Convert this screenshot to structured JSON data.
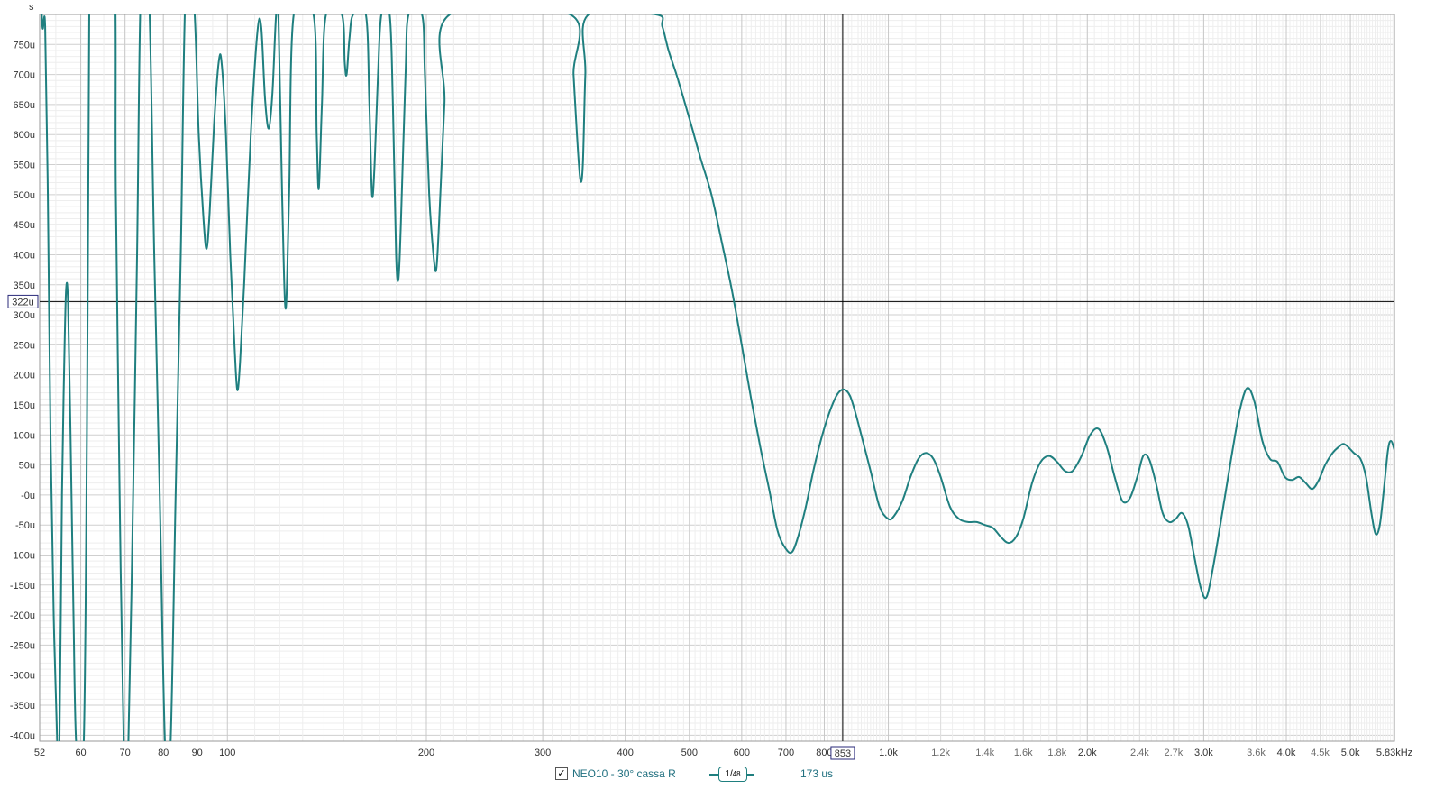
{
  "chart_data": {
    "type": "line",
    "y_unit_label": "s",
    "x_scale": "log",
    "x_range_hz": [
      52,
      5830
    ],
    "y_range_us": [
      -410,
      800
    ],
    "yticks": [
      750,
      700,
      650,
      600,
      550,
      500,
      450,
      400,
      350,
      300,
      250,
      200,
      150,
      100,
      50,
      0,
      -50,
      -100,
      -150,
      -200,
      -250,
      -300,
      -350,
      -400
    ],
    "ytick_labels": [
      "750u",
      "700u",
      "650u",
      "600u",
      "550u",
      "500u",
      "450u",
      "400u",
      "350u",
      "300u",
      "250u",
      "200u",
      "150u",
      "100u",
      "50u",
      "-0u",
      "-50u",
      "-100u",
      "-150u",
      "-200u",
      "-250u",
      "-300u",
      "-350u",
      "-400u"
    ],
    "xticks": [
      {
        "v": 52,
        "label": "52",
        "major": true
      },
      {
        "v": 60,
        "label": "60",
        "major": true
      },
      {
        "v": 70,
        "label": "70",
        "major": true
      },
      {
        "v": 80,
        "label": "80",
        "major": true
      },
      {
        "v": 90,
        "label": "90",
        "major": true
      },
      {
        "v": 100,
        "label": "100",
        "major": true
      },
      {
        "v": 200,
        "label": "200",
        "major": true
      },
      {
        "v": 300,
        "label": "300",
        "major": true
      },
      {
        "v": 400,
        "label": "400",
        "major": true
      },
      {
        "v": 500,
        "label": "500",
        "major": true
      },
      {
        "v": 600,
        "label": "600",
        "major": true
      },
      {
        "v": 700,
        "label": "700",
        "major": true
      },
      {
        "v": 800,
        "label": "800",
        "major": true
      },
      {
        "v": 1000,
        "label": "1.0k",
        "major": true
      },
      {
        "v": 1200,
        "label": "1.2k",
        "major": false
      },
      {
        "v": 1400,
        "label": "1.4k",
        "major": false
      },
      {
        "v": 1600,
        "label": "1.6k",
        "major": false
      },
      {
        "v": 1800,
        "label": "1.8k",
        "major": false
      },
      {
        "v": 2000,
        "label": "2.0k",
        "major": true
      },
      {
        "v": 2400,
        "label": "2.4k",
        "major": false
      },
      {
        "v": 2700,
        "label": "2.7k",
        "major": false
      },
      {
        "v": 3000,
        "label": "3.0k",
        "major": true
      },
      {
        "v": 3600,
        "label": "3.6k",
        "major": false
      },
      {
        "v": 4000,
        "label": "4.0k",
        "major": true
      },
      {
        "v": 4500,
        "label": "4.5k",
        "major": false
      },
      {
        "v": 5000,
        "label": "5.0k",
        "major": true
      },
      {
        "v": 5830,
        "label": "5.83kHz",
        "major": true
      }
    ],
    "cursor": {
      "x_hz": 853,
      "y_us": 322,
      "x_label": "853",
      "y_label": "322u"
    },
    "series": [
      {
        "name": "NEO10 - 30°  cassa R",
        "color": "#1f7f7f",
        "points": [
          [
            52,
            900
          ],
          [
            52.5,
            780
          ],
          [
            53,
            780
          ],
          [
            53.5,
            500
          ],
          [
            54,
            100
          ],
          [
            54.6,
            -200
          ],
          [
            55.3,
            -420
          ],
          [
            55.7,
            -420
          ],
          [
            56.2,
            0
          ],
          [
            56.6,
            200
          ],
          [
            57,
            340
          ],
          [
            57.4,
            320
          ],
          [
            57.9,
            100
          ],
          [
            58.5,
            -200
          ],
          [
            59.1,
            -420
          ],
          [
            60.6,
            -420
          ],
          [
            61.3,
            100
          ],
          [
            61.8,
            800
          ],
          [
            62.3,
            900
          ],
          [
            67.2,
            900
          ],
          [
            67.8,
            500
          ],
          [
            68.7,
            0
          ],
          [
            69.7,
            -420
          ],
          [
            70.8,
            -420
          ],
          [
            72,
            0
          ],
          [
            73,
            400
          ],
          [
            74,
            850
          ],
          [
            76,
            850
          ],
          [
            77.5,
            400
          ],
          [
            79,
            0
          ],
          [
            80.5,
            -420
          ],
          [
            82,
            -420
          ],
          [
            83.5,
            0
          ],
          [
            85,
            400
          ],
          [
            86.5,
            850
          ],
          [
            89,
            820
          ],
          [
            90.5,
            600
          ],
          [
            92,
            460
          ],
          [
            93,
            410
          ],
          [
            94,
            470
          ],
          [
            95.5,
            620
          ],
          [
            97,
            720
          ],
          [
            98,
            720
          ],
          [
            99.5,
            600
          ],
          [
            101,
            400
          ],
          [
            102.5,
            250
          ],
          [
            103.5,
            175
          ],
          [
            104.5,
            220
          ],
          [
            106,
            350
          ],
          [
            108.5,
            600
          ],
          [
            111,
            770
          ],
          [
            112.5,
            780
          ],
          [
            114,
            660
          ],
          [
            115.5,
            610
          ],
          [
            117,
            670
          ],
          [
            118.5,
            800
          ],
          [
            119.5,
            790
          ],
          [
            121,
            500
          ],
          [
            122.5,
            310
          ],
          [
            124,
            500
          ],
          [
            126,
            800
          ],
          [
            135,
            800
          ],
          [
            136.5,
            600
          ],
          [
            137.5,
            510
          ],
          [
            139,
            650
          ],
          [
            141,
            800
          ],
          [
            149,
            800
          ],
          [
            150.5,
            720
          ],
          [
            151.5,
            700
          ],
          [
            153,
            760
          ],
          [
            155,
            800
          ],
          [
            162,
            800
          ],
          [
            164,
            650
          ],
          [
            165.5,
            500
          ],
          [
            167,
            550
          ],
          [
            169,
            700
          ],
          [
            171,
            800
          ],
          [
            176,
            800
          ],
          [
            178,
            650
          ],
          [
            180,
            400
          ],
          [
            181.5,
            360
          ],
          [
            183,
            450
          ],
          [
            186,
            700
          ],
          [
            188,
            800
          ],
          [
            197,
            800
          ],
          [
            199,
            700
          ],
          [
            202,
            500
          ],
          [
            205,
            400
          ],
          [
            207,
            375
          ],
          [
            209,
            450
          ],
          [
            213,
            650
          ],
          [
            217,
            800
          ],
          [
            330,
            800
          ],
          [
            334,
            700
          ],
          [
            338,
            600
          ],
          [
            342,
            525
          ],
          [
            345,
            550
          ],
          [
            348,
            700
          ],
          [
            352,
            800
          ],
          [
            445,
            800
          ],
          [
            455,
            780
          ],
          [
            465,
            740
          ],
          [
            478,
            700
          ],
          [
            490,
            660
          ],
          [
            505,
            610
          ],
          [
            520,
            560
          ],
          [
            540,
            500
          ],
          [
            560,
            420
          ],
          [
            580,
            340
          ],
          [
            600,
            250
          ],
          [
            620,
            160
          ],
          [
            640,
            80
          ],
          [
            660,
            10
          ],
          [
            680,
            -60
          ],
          [
            700,
            -90
          ],
          [
            715,
            -95
          ],
          [
            730,
            -70
          ],
          [
            750,
            -20
          ],
          [
            770,
            40
          ],
          [
            790,
            90
          ],
          [
            810,
            130
          ],
          [
            830,
            160
          ],
          [
            845,
            173
          ],
          [
            860,
            175
          ],
          [
            875,
            165
          ],
          [
            890,
            140
          ],
          [
            910,
            100
          ],
          [
            940,
            40
          ],
          [
            970,
            -20
          ],
          [
            1000,
            -40
          ],
          [
            1020,
            -35
          ],
          [
            1050,
            -10
          ],
          [
            1080,
            30
          ],
          [
            1110,
            60
          ],
          [
            1140,
            70
          ],
          [
            1170,
            60
          ],
          [
            1200,
            30
          ],
          [
            1240,
            -20
          ],
          [
            1280,
            -40
          ],
          [
            1320,
            -45
          ],
          [
            1360,
            -45
          ],
          [
            1400,
            -50
          ],
          [
            1440,
            -55
          ],
          [
            1480,
            -70
          ],
          [
            1520,
            -80
          ],
          [
            1560,
            -70
          ],
          [
            1600,
            -40
          ],
          [
            1650,
            20
          ],
          [
            1700,
            55
          ],
          [
            1750,
            65
          ],
          [
            1800,
            55
          ],
          [
            1850,
            40
          ],
          [
            1900,
            40
          ],
          [
            1960,
            65
          ],
          [
            2020,
            100
          ],
          [
            2080,
            110
          ],
          [
            2140,
            80
          ],
          [
            2200,
            30
          ],
          [
            2260,
            -10
          ],
          [
            2320,
            -5
          ],
          [
            2380,
            30
          ],
          [
            2430,
            65
          ],
          [
            2480,
            60
          ],
          [
            2540,
            20
          ],
          [
            2600,
            -30
          ],
          [
            2660,
            -45
          ],
          [
            2720,
            -40
          ],
          [
            2780,
            -30
          ],
          [
            2840,
            -50
          ],
          [
            2900,
            -100
          ],
          [
            2970,
            -155
          ],
          [
            3030,
            -170
          ],
          [
            3100,
            -120
          ],
          [
            3200,
            -30
          ],
          [
            3300,
            60
          ],
          [
            3400,
            140
          ],
          [
            3490,
            178
          ],
          [
            3580,
            155
          ],
          [
            3680,
            90
          ],
          [
            3780,
            60
          ],
          [
            3880,
            55
          ],
          [
            3980,
            30
          ],
          [
            4080,
            25
          ],
          [
            4180,
            30
          ],
          [
            4280,
            20
          ],
          [
            4380,
            10
          ],
          [
            4480,
            25
          ],
          [
            4580,
            50
          ],
          [
            4700,
            70
          ],
          [
            4800,
            80
          ],
          [
            4880,
            85
          ],
          [
            4960,
            80
          ],
          [
            5060,
            70
          ],
          [
            5180,
            60
          ],
          [
            5280,
            30
          ],
          [
            5380,
            -30
          ],
          [
            5460,
            -65
          ],
          [
            5540,
            -50
          ],
          [
            5620,
            10
          ],
          [
            5700,
            75
          ],
          [
            5760,
            90
          ],
          [
            5830,
            75
          ]
        ]
      }
    ]
  },
  "legend": {
    "checkbox_mark": "✓",
    "series_label": "NEO10 - 30°  cassa R",
    "smoothing_num": "1",
    "smoothing_den": "48",
    "delay": "173 us"
  }
}
